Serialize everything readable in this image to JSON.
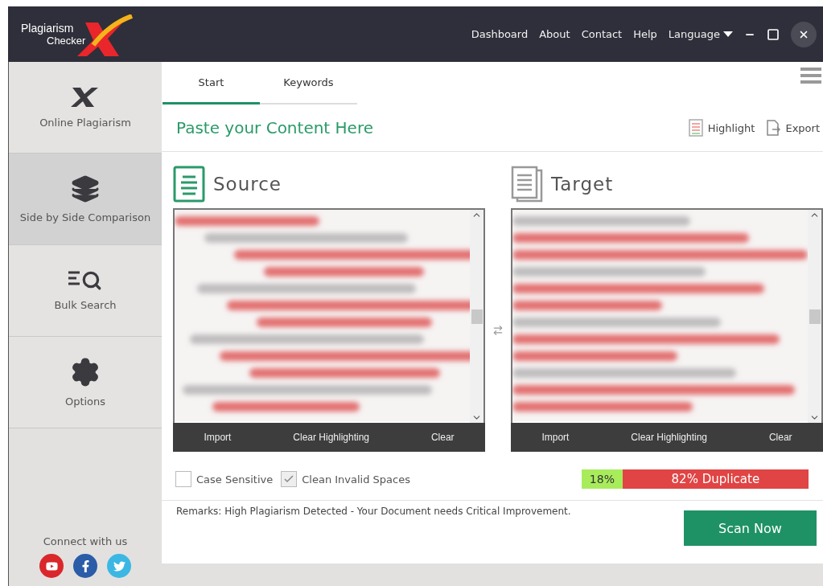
{
  "logo": {
    "line1": "Plagiarism",
    "line2": "Checker"
  },
  "nav": [
    {
      "label": "Dashboard",
      "kind": "link"
    },
    {
      "label": "About",
      "kind": "link"
    },
    {
      "label": "Contact",
      "kind": "link"
    },
    {
      "label": "Help",
      "kind": "link"
    },
    {
      "label": "Language",
      "kind": "dropdown"
    }
  ],
  "sidebar": {
    "items": [
      {
        "label": "Online Plagiarism",
        "kind": "online",
        "selected": false
      },
      {
        "label": "Side by Side Comparison",
        "kind": "compare",
        "selected": true
      },
      {
        "label": "Bulk Search",
        "kind": "bulk",
        "selected": false
      },
      {
        "label": "Options",
        "kind": "options",
        "selected": false
      }
    ],
    "connect": {
      "label": "Connect with us",
      "networks": [
        {
          "kind": "youtube"
        },
        {
          "kind": "facebook"
        },
        {
          "kind": "twitter"
        }
      ]
    }
  },
  "tabs": [
    {
      "label": "Start",
      "selected": true
    },
    {
      "label": "Keywords",
      "selected": false
    }
  ],
  "heading": "Paste your Content Here",
  "actions": [
    {
      "label": "Highlight",
      "kind": "highlight"
    },
    {
      "label": "Export",
      "kind": "export"
    }
  ],
  "panels": [
    {
      "title": "Source",
      "kind": "source",
      "buttons": [
        "Import",
        "Clear Highlighting",
        "Clear"
      ]
    },
    {
      "title": "Target",
      "kind": "target",
      "buttons": [
        "Import",
        "Clear Highlighting",
        "Clear"
      ]
    }
  ],
  "options": [
    {
      "label": "Case Sensitive",
      "checked": false
    },
    {
      "label": "Clean Invalid Spaces",
      "checked": true
    }
  ],
  "result": {
    "unique": "18%",
    "duplicate": "82% Duplicate",
    "level": 0.18
  },
  "remarks": "Remarks: High Plagiarism Detected - Your Document needs Critical Improvement.",
  "scan_button": "Scan Now"
}
